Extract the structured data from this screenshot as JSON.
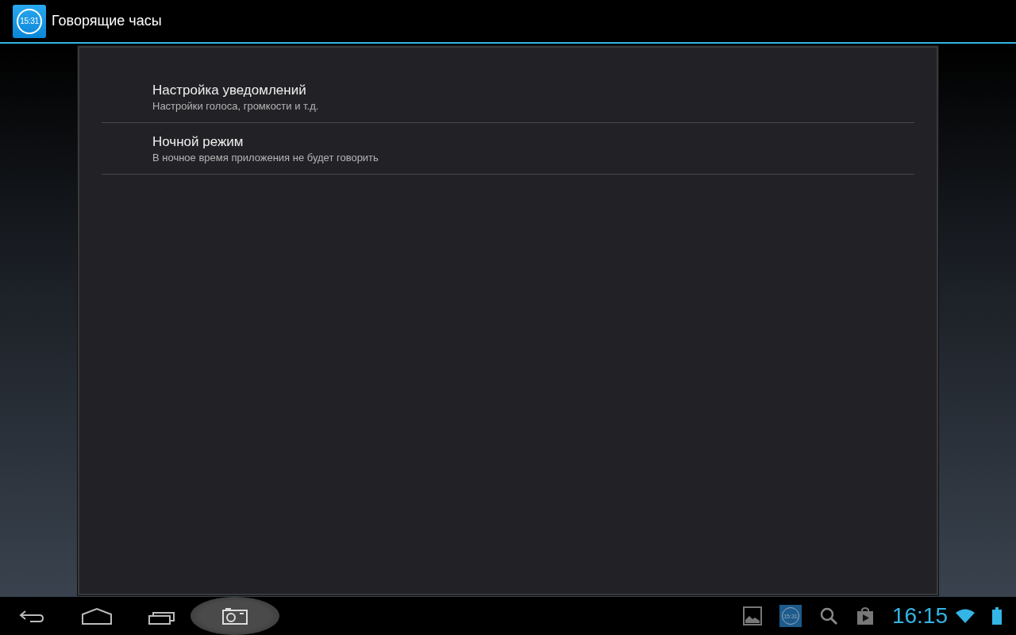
{
  "action_bar": {
    "icon_text": "15:31",
    "title": "Говорящие часы"
  },
  "preferences": [
    {
      "title": "Настройка уведомлений",
      "summary": "Настройки голоса, громкости и т.д."
    },
    {
      "title": "Ночной режим",
      "summary": "В ночное время приложения не будет говорить"
    }
  ],
  "system_bar": {
    "notification_icon_text": "15:31",
    "clock": "16:15"
  }
}
